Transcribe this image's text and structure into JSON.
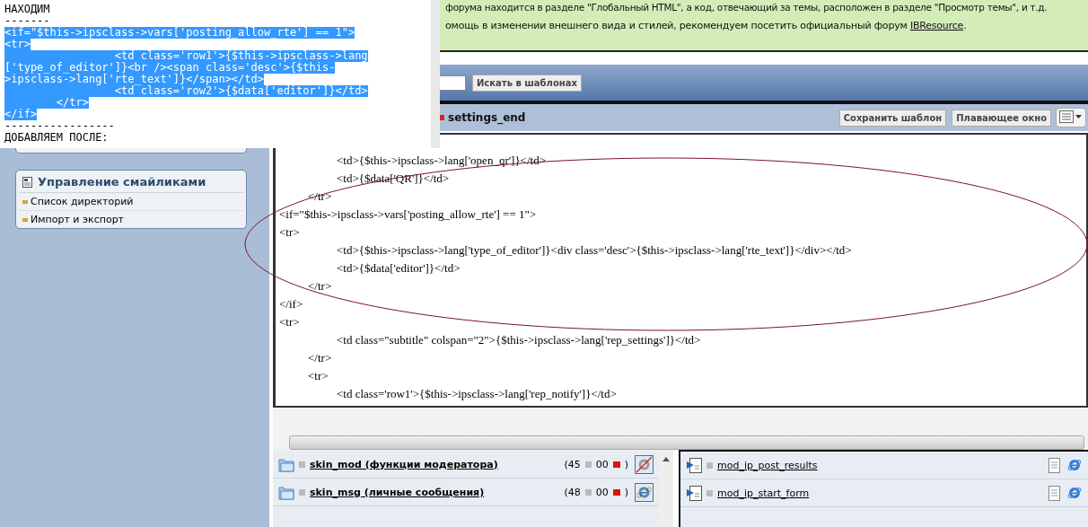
{
  "note_popup": {
    "lines": [
      {
        "text": "НАХОДИМ",
        "selected": false
      },
      {
        "text": "-------",
        "selected": false
      },
      {
        "text": "<if=\"$this->ipsclass->vars['posting_allow_rte'] == 1\">",
        "selected": true
      },
      {
        "text": "<tr>",
        "selected": true
      },
      {
        "text": "                 <td class='row1'>{$this->ipsclass->lang",
        "selected": true
      },
      {
        "text": "['type_of_editor']}<br /><span class='desc'>{$this-",
        "selected": true
      },
      {
        "text": ">ipsclass->lang['rte_text']}</span></td>",
        "selected": true
      },
      {
        "text": "                 <td class='row2'>{$data['editor']}</td>",
        "selected": true
      },
      {
        "text": "        </tr>",
        "selected": true
      },
      {
        "text": "</if>",
        "selected": true
      },
      {
        "text": "-----------------",
        "selected": false
      },
      {
        "text": "ДОБАВЛЯЕМ ПОСЛЕ:",
        "selected": false
      }
    ]
  },
  "sidebar": {
    "title": "Управление смайликами",
    "items": [
      "Список директорий",
      "Импорт и экспорт"
    ]
  },
  "info_box": {
    "lines": [
      {
        "text": "форума находится в разделе \"Глобальный HTML\", а код, отвечающий за темы, расположен в разделе \"Просмотр темы\", и т.д."
      },
      {
        "text": "омощь в изменении внешнего вида и стилей, рекомендуем посетить официальный форум ",
        "link": "IBResource",
        "after": "."
      }
    ]
  },
  "search": {
    "button": "Искать в шаблонах"
  },
  "template_header": {
    "title": "settings_end",
    "buttons": [
      "Сохранить шаблон",
      "Плавающее окно"
    ]
  },
  "editor": {
    "lines": [
      "\t\t<td>{$this->ipsclass->lang['open_qr']}</td>",
      "\t\t<td>{$data['QR']}</td>",
      "\t</tr>",
      "<if=\"$this->ipsclass->vars['posting_allow_rte'] == 1\">",
      "<tr>",
      "\t\t<td>{$this->ipsclass->lang['type_of_editor']}<div class='desc'>{$this->ipsclass->lang['rte_text']}</div></td>",
      "\t\t<td>{$data['editor']}</td>",
      "\t</tr>",
      "</if>",
      "<tr>",
      "\t\t<td class=\"subtitle\" colspan=\"2\">{$this->ipsclass->lang['rep_settings']}</td>",
      "\t</tr>",
      "\t<tr>",
      "\t\t<td class='row1'>{$this->ipsclass->lang['rep_notify']}</td>"
    ]
  },
  "template_groups": [
    {
      "name": "skin_mod (функции модератора)",
      "count": "(45",
      "new_count": "00",
      "close": ")",
      "preview_disabled": true
    },
    {
      "name": "skin_msg (личные сообщения)",
      "count": "(48",
      "new_count": "00",
      "close": ")",
      "preview_disabled": false
    }
  ],
  "templates": [
    {
      "name": "mod_ip_post_results"
    },
    {
      "name": "mod_ip_start_form"
    }
  ]
}
